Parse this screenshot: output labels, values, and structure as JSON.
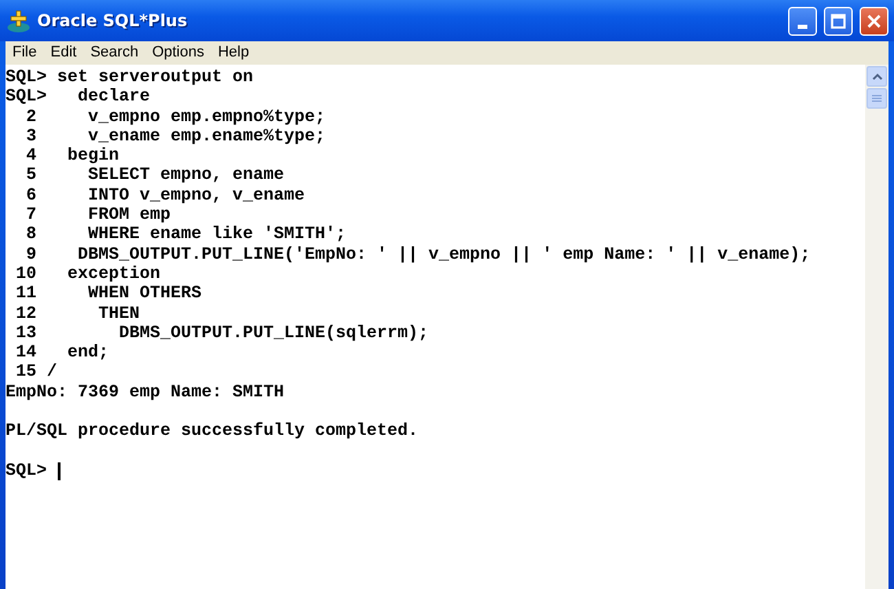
{
  "window": {
    "title": "Oracle SQL*Plus"
  },
  "menu": [
    "File",
    "Edit",
    "Search",
    "Options",
    "Help"
  ],
  "console_lines": [
    {
      "text": "SQL> set serveroutput on"
    },
    {
      "text": "SQL>   declare"
    },
    {
      "text": "  2     v_empno emp.empno%type;"
    },
    {
      "text": "  3     v_ename emp.ename%type;"
    },
    {
      "text": "  4   begin"
    },
    {
      "text": "  5     SELECT empno, ename"
    },
    {
      "text": "  6     INTO v_empno, v_ename"
    },
    {
      "text": "  7     FROM emp"
    },
    {
      "text": "  8     WHERE ename like 'SMITH';"
    },
    {
      "text": "  9    DBMS_OUTPUT.PUT_LINE('EmpNo: ' || v_empno || ' emp Name: ' || v_ename);"
    },
    {
      "text": " 10   exception"
    },
    {
      "text": " 11     WHEN OTHERS"
    },
    {
      "text": " 12      THEN"
    },
    {
      "text": " 13        DBMS_OUTPUT.PUT_LINE(sqlerrm);"
    },
    {
      "text": " 14   end;"
    },
    {
      "text": " 15 /"
    },
    {
      "text": "EmpNo: 7369 emp Name: SMITH"
    },
    {
      "text": "PL/SQL procedure successfully completed.",
      "blank_before": true
    },
    {
      "text": "SQL> ",
      "blank_before": true,
      "cursor": true
    }
  ]
}
